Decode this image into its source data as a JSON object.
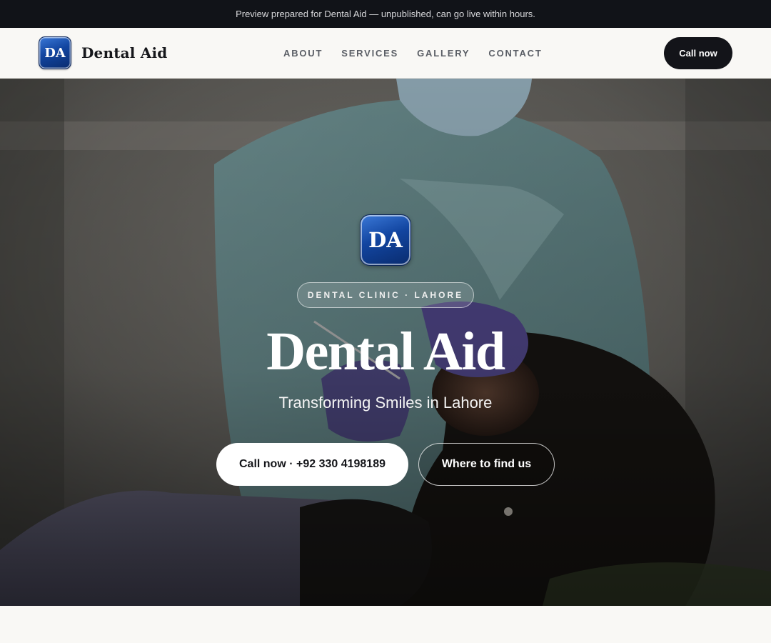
{
  "announcement": "Preview prepared for Dental Aid — unpublished, can go live within hours.",
  "header": {
    "logo_text": "DA",
    "brand_name": "Dental Aid",
    "nav": [
      {
        "label": "ABOUT"
      },
      {
        "label": "SERVICES"
      },
      {
        "label": "GALLERY"
      },
      {
        "label": "CONTACT"
      }
    ],
    "cta_label": "Call now"
  },
  "hero": {
    "logo_text": "DA",
    "eyebrow": "DENTAL CLINIC · LAHORE",
    "title": "Dental Aid",
    "subtitle": "Transforming Smiles in Lahore",
    "primary_button": "Call now · +92 330 4198189",
    "secondary_button": "Where to find us",
    "background_image": "photo of dentist in teal scrubs and mask treating a patient in dental chair"
  },
  "colors": {
    "topbar_bg": "#111318",
    "page_bg": "#f9f8f5",
    "logo_blue": "#1245a0",
    "cta_dark": "#131419"
  }
}
